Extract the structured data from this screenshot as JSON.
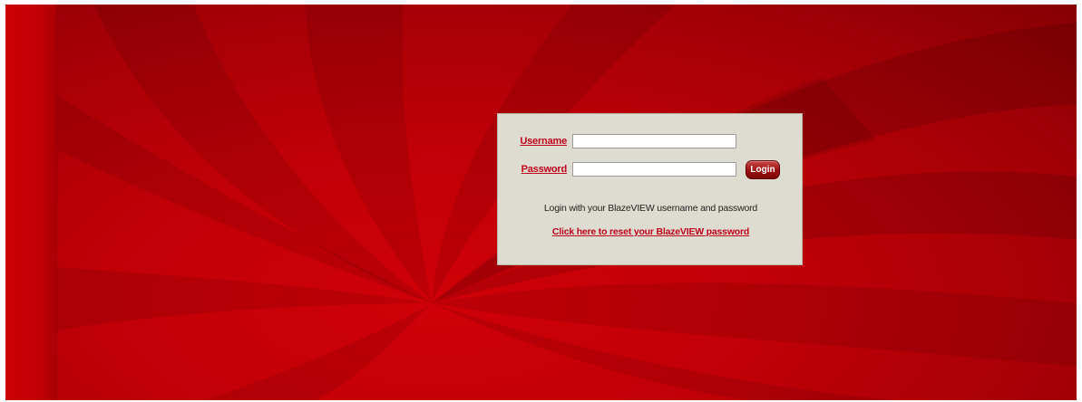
{
  "background": {
    "primary_color": "#c10007",
    "dark_color": "#860004",
    "box_color": "#dedcd0",
    "accent_color": "#c0001a"
  },
  "login": {
    "username_label": "Username",
    "username_value": "",
    "password_label": "Password",
    "password_value": "",
    "button_label": "Login",
    "help_text": "Login with your BlazeVIEW username and password",
    "reset_link": "Click here to reset your BlazeVIEW password"
  }
}
